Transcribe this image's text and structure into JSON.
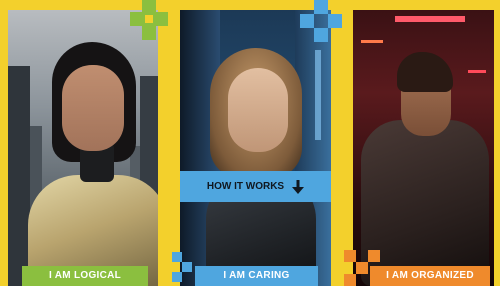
{
  "cards": [
    {
      "caption": "I AM LOGICAL"
    },
    {
      "caption": "I AM CARING"
    },
    {
      "caption": "I AM ORGANIZED"
    }
  ],
  "how_button": {
    "label": "HOW IT WORKS",
    "icon": "arrow-down-icon"
  },
  "colors": {
    "background": "#f3d02c",
    "green": "#8bbf3f",
    "blue": "#4fa6df",
    "orange": "#ef8a2c"
  }
}
